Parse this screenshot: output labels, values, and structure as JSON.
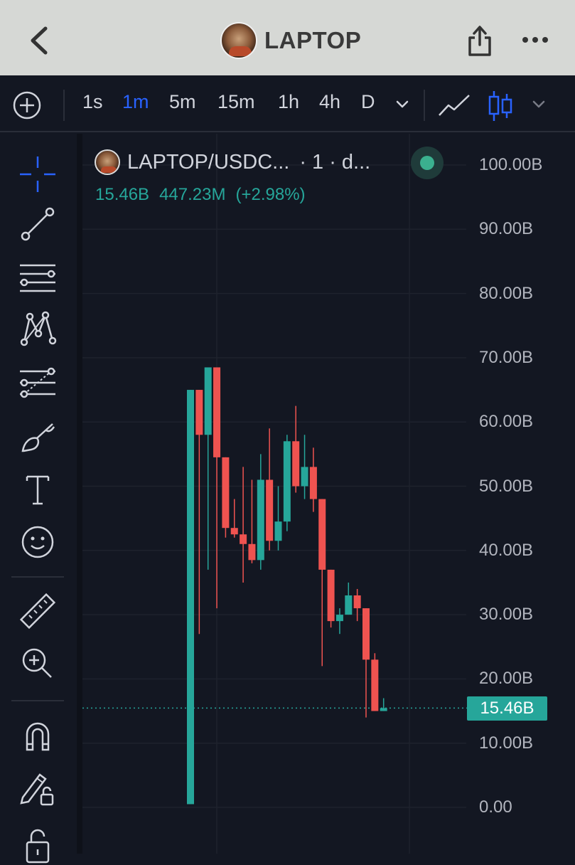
{
  "header": {
    "title": "LAPTOP",
    "back_icon": "chevron-left-icon",
    "share_icon": "share-icon",
    "more_icon": "more-horizontal-icon"
  },
  "toolbar": {
    "timeframes": [
      {
        "label": "1s",
        "active": false
      },
      {
        "label": "1m",
        "active": true
      },
      {
        "label": "5m",
        "active": false
      },
      {
        "label": "15m",
        "active": false
      },
      {
        "label": "1h",
        "active": false
      },
      {
        "label": "4h",
        "active": false
      },
      {
        "label": "D",
        "active": false
      }
    ],
    "accent_color": "#2962ff"
  },
  "sidebar": {
    "tools": [
      "crosshair-icon",
      "trend-line-icon",
      "horizontal-lines-icon",
      "pattern-icon",
      "fib-icon",
      "brush-icon",
      "text-icon",
      "emoji-icon",
      "ruler-icon",
      "zoom-in-icon",
      "magnet-icon",
      "lock-drawing-icon",
      "lock-icon"
    ]
  },
  "legend": {
    "symbol": "LAPTOP/USDC...",
    "meta": "· 1 · d...",
    "last": "15.46B",
    "change": "447.23M",
    "change_pct": "(+2.98%)"
  },
  "chart_data": {
    "type": "candlestick",
    "y_axis_labels": [
      "100.00B",
      "90.00B",
      "80.00B",
      "70.00B",
      "60.00B",
      "50.00B",
      "40.00B",
      "30.00B",
      "20.00B",
      "10.00B",
      "0.00"
    ],
    "ylim": [
      0,
      100
    ],
    "y_unit": "B",
    "current_price": 15.46,
    "current_price_label": "15.46B",
    "up_color": "#26a69a",
    "down_color": "#ef5350",
    "candles": [
      {
        "o": 0.5,
        "h": 65,
        "l": 0.5,
        "c": 65
      },
      {
        "o": 65,
        "h": 65,
        "l": 27,
        "c": 58
      },
      {
        "o": 58,
        "h": 68.5,
        "l": 37,
        "c": 68.5
      },
      {
        "o": 68.5,
        "h": 68.5,
        "l": 31,
        "c": 54.5
      },
      {
        "o": 54.5,
        "h": 54.5,
        "l": 42,
        "c": 43.5
      },
      {
        "o": 43.5,
        "h": 48,
        "l": 42,
        "c": 42.5
      },
      {
        "o": 42.5,
        "h": 53,
        "l": 35,
        "c": 41
      },
      {
        "o": 41,
        "h": 51,
        "l": 38,
        "c": 38.5
      },
      {
        "o": 38.5,
        "h": 55,
        "l": 37,
        "c": 51
      },
      {
        "o": 51,
        "h": 59,
        "l": 40,
        "c": 41.5
      },
      {
        "o": 41.5,
        "h": 50,
        "l": 40,
        "c": 44.5
      },
      {
        "o": 44.5,
        "h": 58,
        "l": 43,
        "c": 57
      },
      {
        "o": 57,
        "h": 62.5,
        "l": 49,
        "c": 50
      },
      {
        "o": 50,
        "h": 58,
        "l": 48,
        "c": 53
      },
      {
        "o": 53,
        "h": 56,
        "l": 46,
        "c": 48
      },
      {
        "o": 48,
        "h": 48,
        "l": 22,
        "c": 37
      },
      {
        "o": 37,
        "h": 37,
        "l": 28,
        "c": 29
      },
      {
        "o": 29,
        "h": 31,
        "l": 27,
        "c": 30
      },
      {
        "o": 30,
        "h": 35,
        "l": 30,
        "c": 33
      },
      {
        "o": 33,
        "h": 34,
        "l": 29,
        "c": 31
      },
      {
        "o": 31,
        "h": 31,
        "l": 14,
        "c": 23
      },
      {
        "o": 23,
        "h": 24,
        "l": 15,
        "c": 15
      },
      {
        "o": 15,
        "h": 17,
        "l": 15,
        "c": 15.46
      }
    ]
  }
}
